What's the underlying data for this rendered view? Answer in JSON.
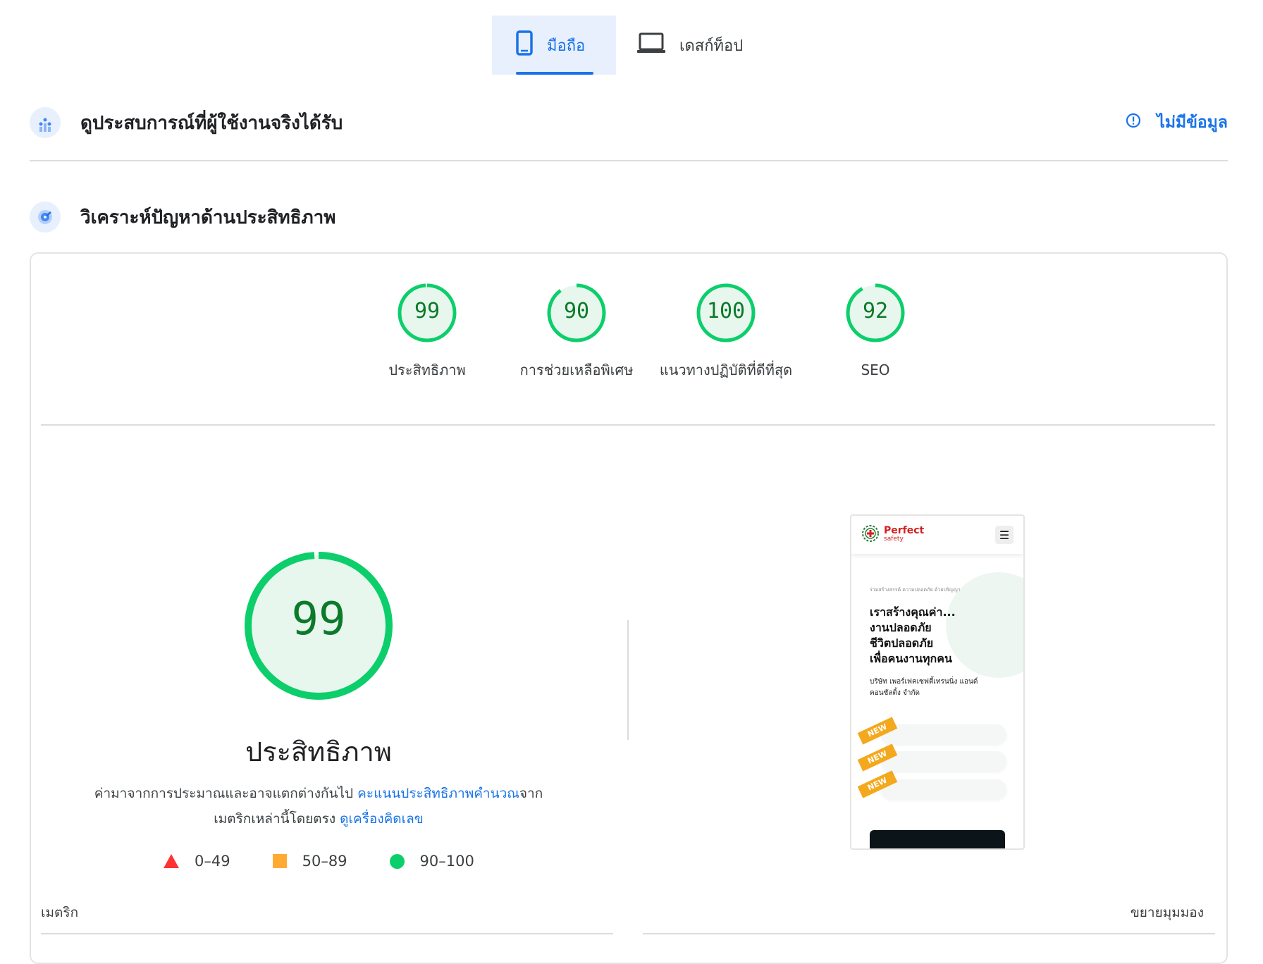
{
  "tabs": {
    "mobile": "มือถือ",
    "desktop": "เดสก์ท็อป"
  },
  "field_data": {
    "title": "ดูประสบการณ์ที่ผู้ใช้งานจริงได้รับ",
    "status": "ไม่มีข้อมูล"
  },
  "diagnose": {
    "title": "วิเคราะห์ปัญหาด้านประสิทธิภาพ"
  },
  "scores": [
    {
      "value": "99",
      "score": 99,
      "label": "ประสิทธิภาพ"
    },
    {
      "value": "90",
      "score": 90,
      "label": "การช่วยเหลือพิเศษ"
    },
    {
      "value": "100",
      "score": 100,
      "label": "แนวทางปฏิบัติที่ดีที่สุด"
    },
    {
      "value": "92",
      "score": 92,
      "label": "SEO"
    }
  ],
  "performance": {
    "score": "99",
    "score_value": 99,
    "title": "ประสิทธิภาพ",
    "desc_text": "ค่ามาจากการประมาณและอาจแตกต่างกันไป",
    "desc_link1": "คะแนนประสิทธิภาพคำนวณ",
    "desc_mid": "จาก",
    "desc_line2": "เมตริกเหล่านี้โดยตรง",
    "desc_link2": "ดูเครื่องคิดเลข"
  },
  "legend": {
    "fail": "0–49",
    "average": "50–89",
    "pass": "90–100"
  },
  "metrics_label": "เมตริก",
  "expand_label": "ขยายมุมมอง",
  "phone": {
    "logo": "Perfect",
    "logo_sub": "safety",
    "small_text": "ร่วมสร้างสรรค์ ความปลอดภัย ด้วยปริญญา",
    "headline": [
      "เราสร้างคุณค่า...",
      "งานปลอดภัย",
      "ชีวิตปลอดภัย",
      "เพื่อคนงานทุกคน"
    ],
    "company": [
      "บริษัท เพอร์เฟคเซฟตี้เทรนนิ่ง แอนด์",
      "คอนซัลติ้ง จำกัด"
    ],
    "tag": "NEW"
  },
  "colors": {
    "pass": "#0cce6b",
    "pass_text": "#0b7a2a",
    "average": "#ffaa33",
    "fail": "#ff3333",
    "link": "#1a73e8"
  }
}
